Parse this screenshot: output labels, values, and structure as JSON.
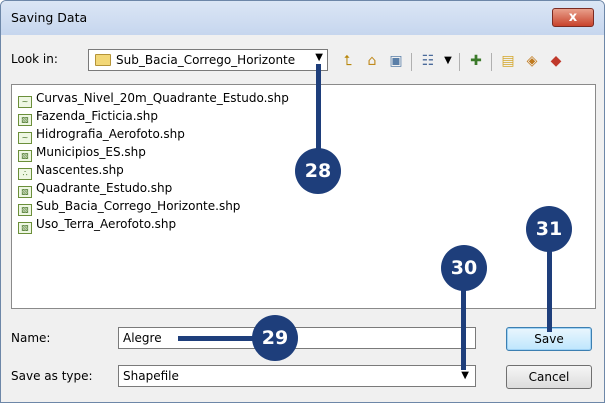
{
  "dialog": {
    "title": "Saving Data",
    "close_label": "x"
  },
  "lookin": {
    "label": "Look in:",
    "value": "Sub_Bacia_Corrego_Horizonte"
  },
  "toolbar": {
    "icons": [
      "up-folder-icon",
      "home-icon",
      "connect-folder-icon",
      "view-options-icon",
      "new-folder-icon",
      "catalog-icon",
      "add-data-icon",
      "toolbox-icon"
    ]
  },
  "files": [
    {
      "name": "Curvas_Nivel_20m_Quadrante_Estudo.shp",
      "type": "line-shapefile"
    },
    {
      "name": "Fazenda_Ficticia.shp",
      "type": "polygon-shapefile"
    },
    {
      "name": "Hidrografia_Aerofoto.shp",
      "type": "line-shapefile"
    },
    {
      "name": "Municipios_ES.shp",
      "type": "polygon-shapefile"
    },
    {
      "name": "Nascentes.shp",
      "type": "point-shapefile"
    },
    {
      "name": "Quadrante_Estudo.shp",
      "type": "polygon-shapefile"
    },
    {
      "name": "Sub_Bacia_Corrego_Horizonte.shp",
      "type": "polygon-shapefile"
    },
    {
      "name": "Uso_Terra_Aerofoto.shp",
      "type": "polygon-shapefile"
    }
  ],
  "name_field": {
    "label": "Name:",
    "value": "Alegre"
  },
  "type_field": {
    "label": "Save as type:",
    "value": "Shapefile"
  },
  "buttons": {
    "save": "Save",
    "cancel": "Cancel"
  },
  "callouts": {
    "c28": "28",
    "c29": "29",
    "c30": "30",
    "c31": "31"
  },
  "colors": {
    "callout": "#1e3e7b",
    "titlebar": "#c6d6ee",
    "close_button": "#c8432c"
  }
}
